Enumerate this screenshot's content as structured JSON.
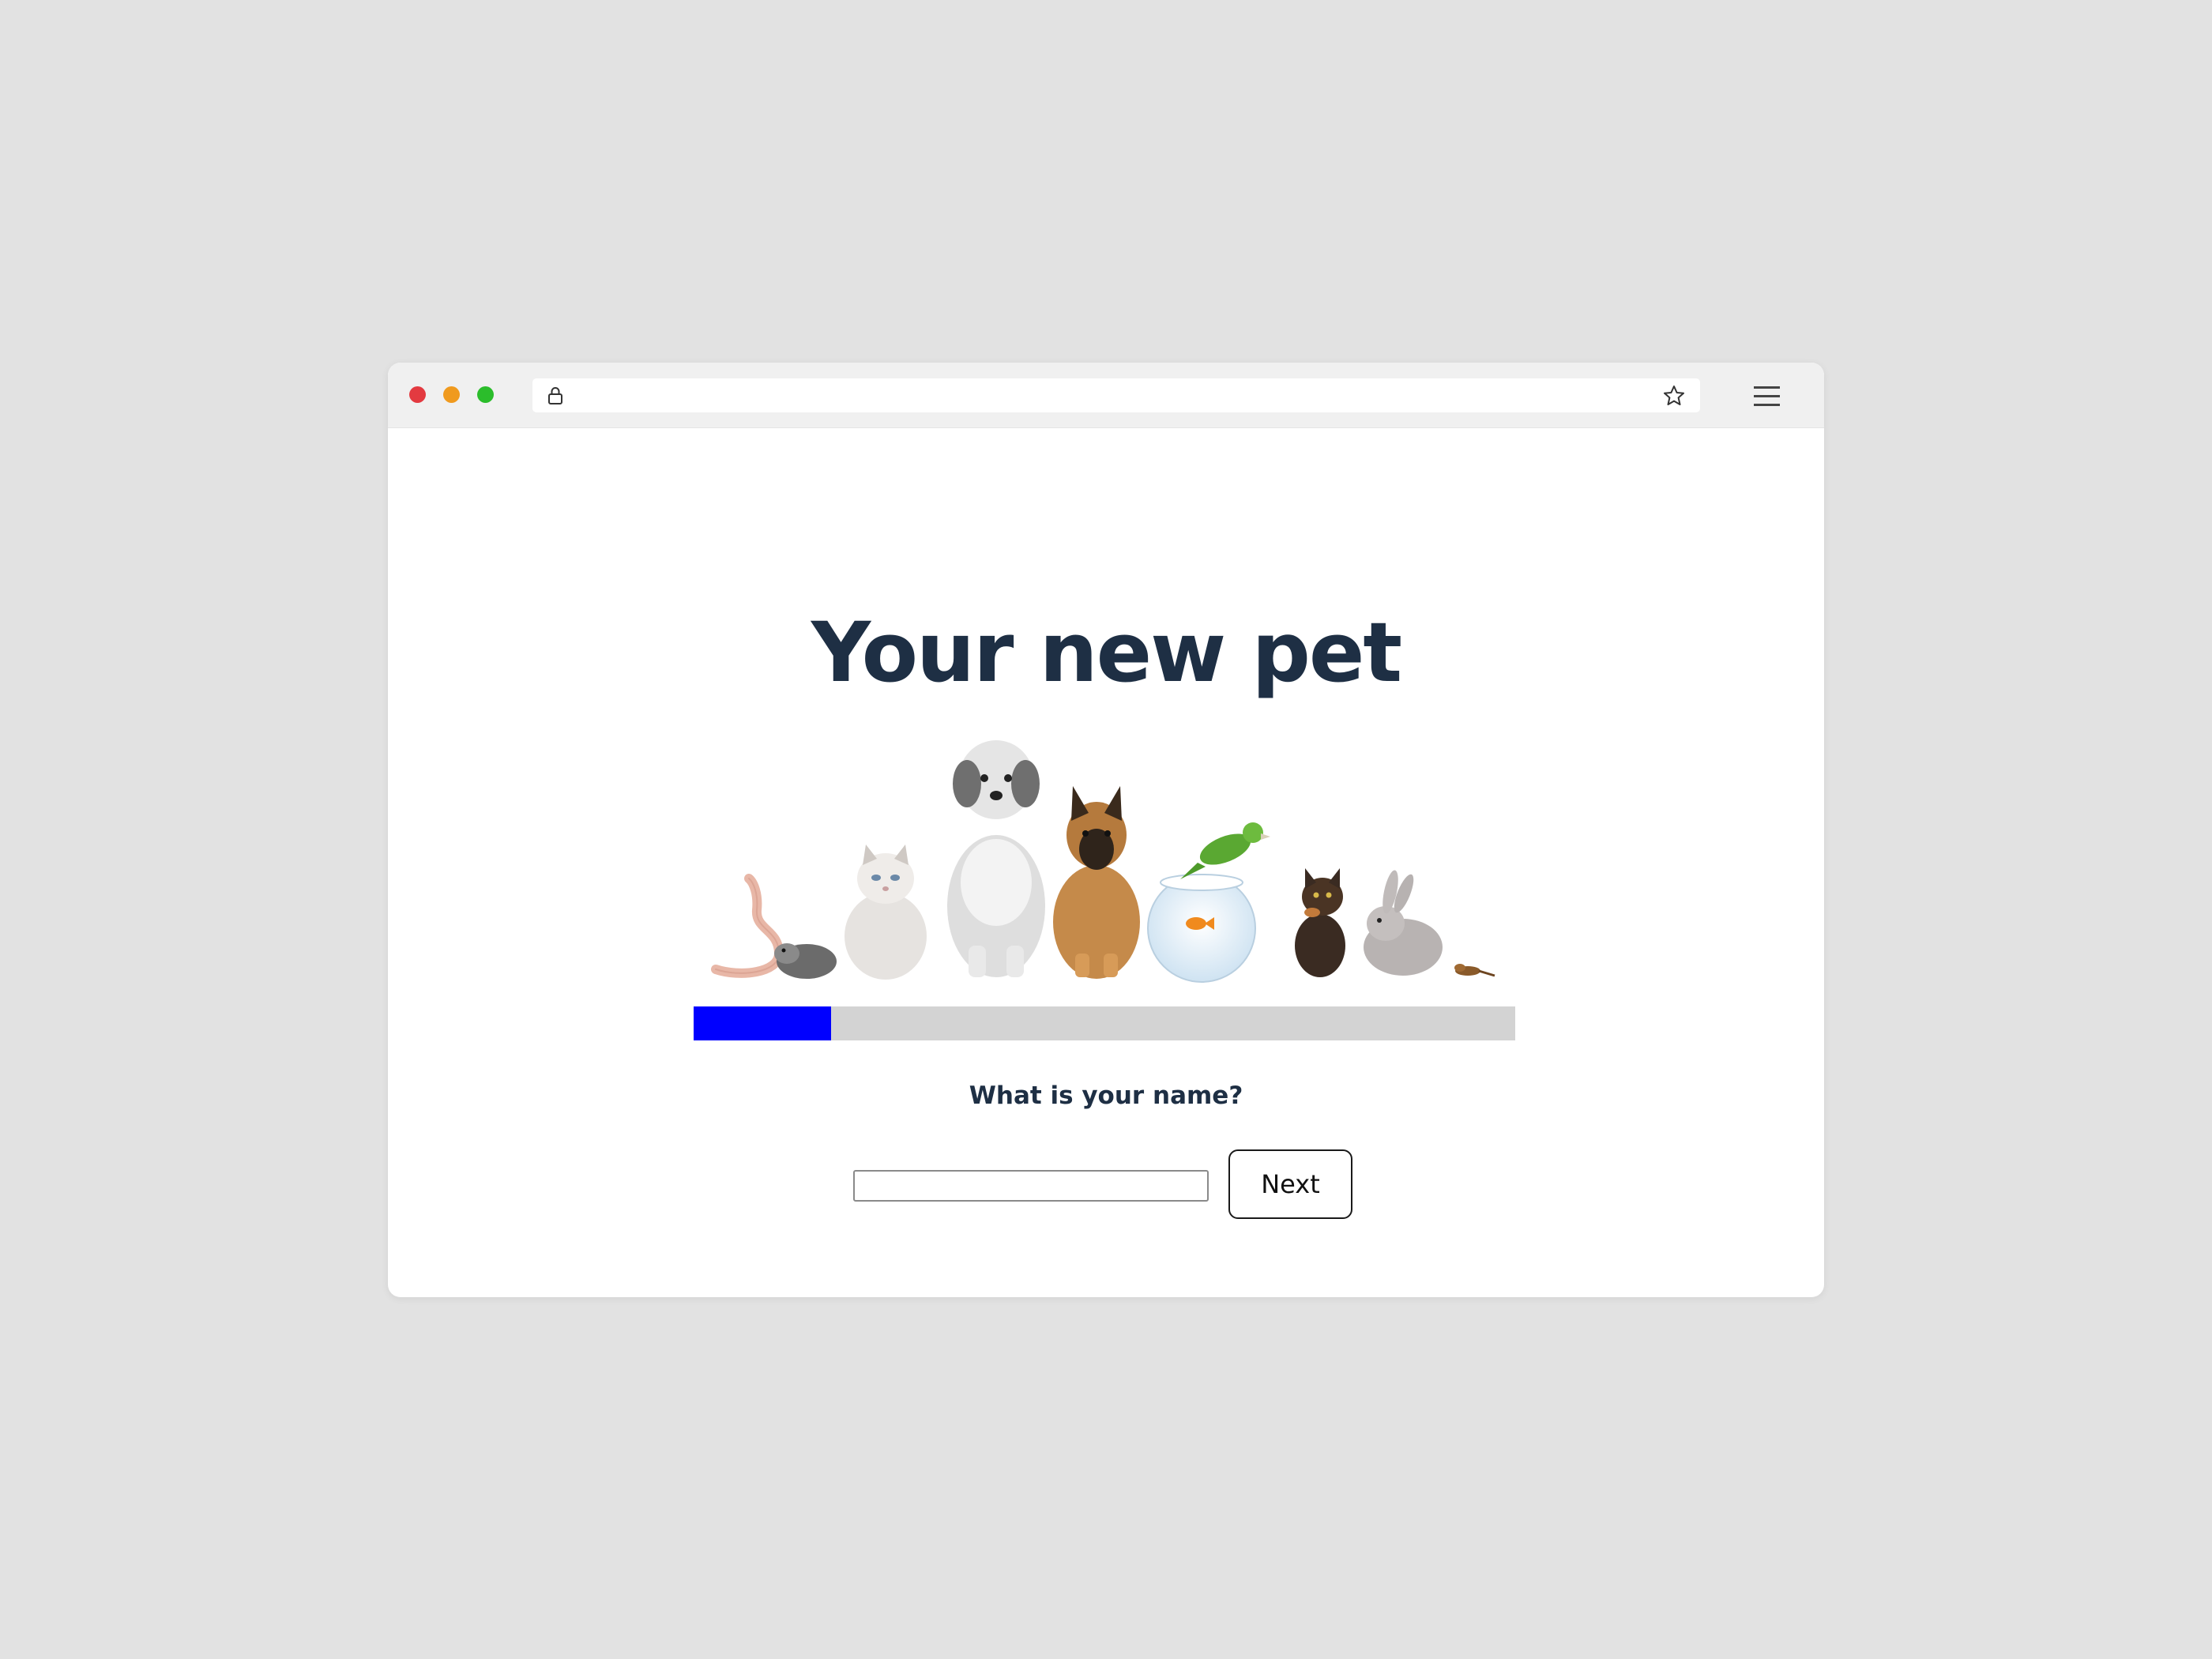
{
  "browser": {
    "icons": [
      "lock-icon",
      "star-icon",
      "menu-icon"
    ],
    "traffic_lights": [
      "#e33a40",
      "#f09a1e",
      "#2bbd2b"
    ]
  },
  "page": {
    "title": "Your new pet",
    "question": "What is your name?",
    "name_input": {
      "value": "",
      "placeholder": ""
    },
    "next_label": "Next",
    "progress_fraction": 0.167
  },
  "colors": {
    "title": "#1e2f44",
    "progress_fill": "#0000ff",
    "progress_track": "#d3d3d3"
  }
}
